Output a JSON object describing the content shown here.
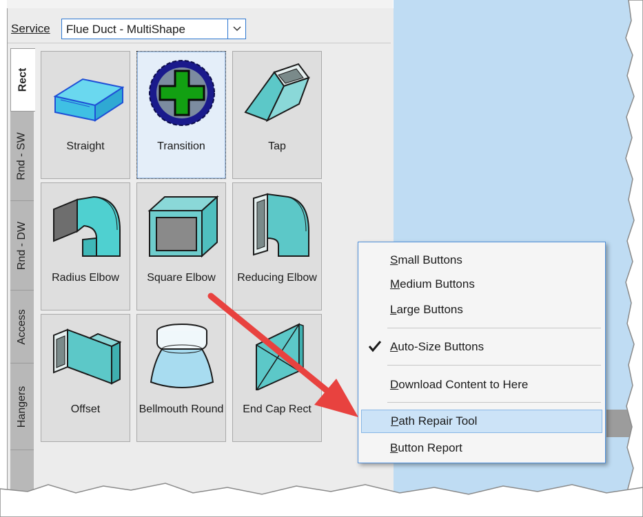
{
  "service": {
    "label_accel": "S",
    "label_rest": "ervice",
    "value": "Flue Duct - MultiShape"
  },
  "tabs": [
    {
      "label": "Rect",
      "active": true
    },
    {
      "label": "Rnd - SW",
      "active": false
    },
    {
      "label": "Rnd - DW",
      "active": false
    },
    {
      "label": "Access",
      "active": false
    },
    {
      "label": "Hangers",
      "active": false
    }
  ],
  "buttons": [
    {
      "label": "Straight",
      "icon": "straight-duct-icon"
    },
    {
      "label": "Transition",
      "icon": "add-icon",
      "selected": true
    },
    {
      "label": "Tap",
      "icon": "tap-duct-icon"
    },
    {
      "label": "Radius Elbow",
      "icon": "radius-elbow-icon"
    },
    {
      "label": "Square Elbow",
      "icon": "square-elbow-icon"
    },
    {
      "label": "Reducing Elbow",
      "icon": "reducing-elbow-icon"
    },
    {
      "label": "Offset",
      "icon": "offset-duct-icon"
    },
    {
      "label": "Bellmouth Round",
      "icon": "bellmouth-round-icon"
    },
    {
      "label": "End Cap Rect",
      "icon": "end-cap-rect-icon"
    }
  ],
  "context_menu": {
    "items": [
      {
        "accel": "S",
        "rest": "mall Buttons"
      },
      {
        "accel": "M",
        "rest": "edium Buttons"
      },
      {
        "accel": "L",
        "rest": "arge Buttons"
      },
      {
        "accel": "A",
        "rest": "uto-Size Buttons",
        "checked": true
      },
      {
        "accel": "D",
        "rest": "ownload Content to Here"
      },
      {
        "accel": "P",
        "rest": "ath Repair Tool",
        "highlighted": true
      },
      {
        "accel": "B",
        "rest": "utton Report"
      }
    ]
  },
  "colors": {
    "accent": "#2b76d1",
    "duct": "#5cc8c8",
    "arrow": "#e8423f",
    "viewport": "#bfdcf3"
  }
}
